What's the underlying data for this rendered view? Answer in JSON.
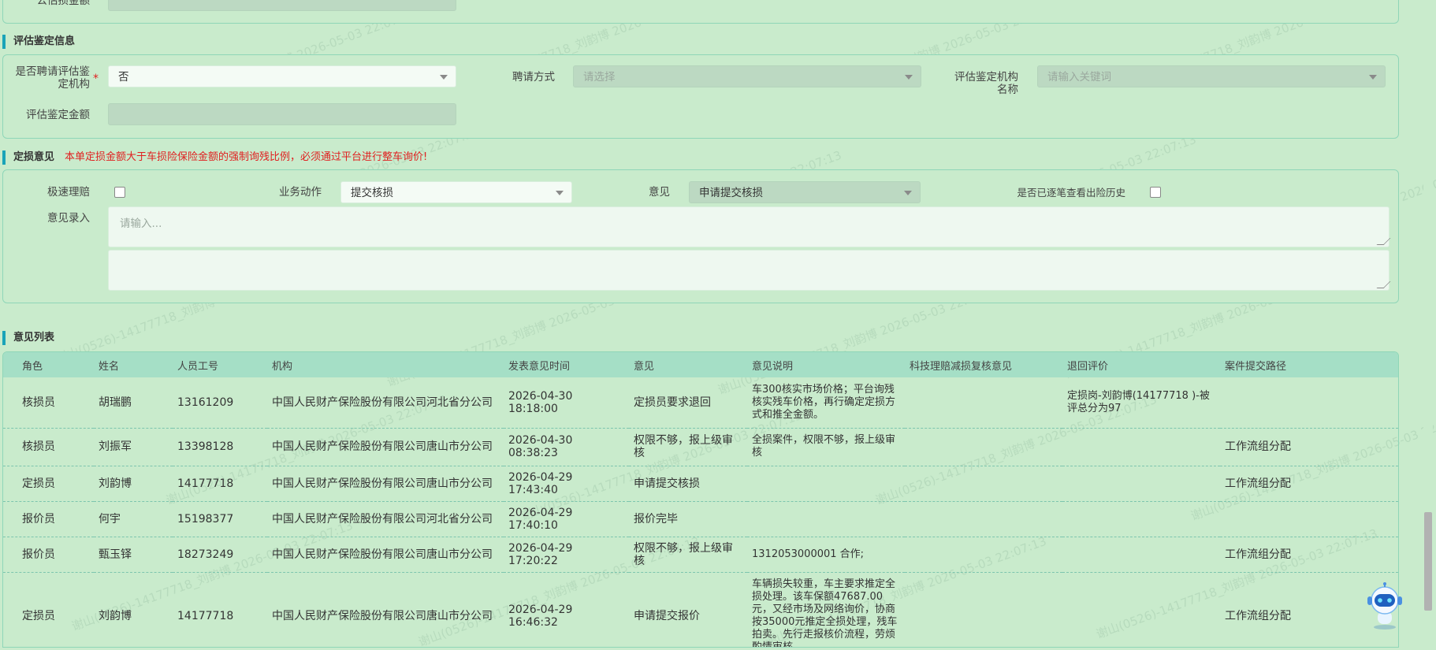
{
  "top_section": {
    "partial_label": "公估损金额"
  },
  "assessment": {
    "title": "评估鉴定信息",
    "hire_label": "是否聘请评估鉴定机构",
    "hire_value": "否",
    "hire_method_label": "聘请方式",
    "hire_method_placeholder": "请选择",
    "institution_label": "评估鉴定机构名称",
    "institution_placeholder": "请输入关键词",
    "amount_label": "评估鉴定金额"
  },
  "opinion": {
    "title": "定损意见",
    "warning": "本单定损金额大于车损险保险金额的强制询残比例，必须通过平台进行整车询价!",
    "warning_color": "#e02020",
    "fast_claim_label": "极速理赔",
    "business_action_label": "业务动作",
    "business_action_value": "提交核损",
    "opinion_label": "意见",
    "opinion_value": "申请提交核损",
    "history_label": "是否已逐笔查看出险历史",
    "opinion_input_label": "意见录入",
    "opinion_input_placeholder": "请输入..."
  },
  "opinion_list": {
    "title": "意见列表",
    "columns": [
      "角色",
      "姓名",
      "人员工号",
      "机构",
      "发表意见时间",
      "意见",
      "意见说明",
      "科技理赔减损复核意见",
      "退回评价",
      "案件提交路径"
    ],
    "rows": [
      [
        "核损员",
        "胡瑞鹏",
        "13161209",
        "中国人民财产保险股份有限公司河北省分公司",
        "2026-04-30 18:18:00",
        "定损员要求退回",
        "车300核实市场价格；平台询残核实残车价格，再行确定定损方式和推全金额。",
        "",
        "定损岗-刘韵博(14177718 )-被评总分为97",
        ""
      ],
      [
        "核损员",
        "刘振军",
        "13398128",
        "中国人民财产保险股份有限公司唐山市分公司",
        "2026-04-30 08:38:23",
        "权限不够，报上级审核",
        "全损案件，权限不够，报上级审核",
        "",
        "",
        "工作流组分配"
      ],
      [
        "定损员",
        "刘韵博",
        "14177718",
        "中国人民财产保险股份有限公司唐山市分公司",
        "2026-04-29 17:43:40",
        "申请提交核损",
        "",
        "",
        "",
        "工作流组分配"
      ],
      [
        "报价员",
        "何宇",
        "15198377",
        "中国人民财产保险股份有限公司河北省分公司",
        "2026-04-29 17:40:10",
        "报价完毕",
        "",
        "",
        "",
        ""
      ],
      [
        "报价员",
        "甄玉铎",
        "18273249",
        "中国人民财产保险股份有限公司唐山市分公司",
        "2026-04-29 17:20:22",
        "权限不够，报上级审核",
        "1312053000001 合作;",
        "",
        "",
        "工作流组分配"
      ],
      [
        "定损员",
        "刘韵博",
        "14177718",
        "中国人民财产保险股份有限公司唐山市分公司",
        "2026-04-29 16:46:32",
        "申请提交报价",
        "车辆损失较重，车主要求推定全损处理。该车保额47687.00元，又经市场及网络询价，协商按35000元推定全损处理，残车拍卖。先行走报核价流程，劳烦酌情审核。",
        "",
        "",
        "工作流组分配"
      ]
    ]
  },
  "watermark_text": "谢山(0526)-14177718_刘韵博 2026-05-03 22:07:13",
  "colors": {
    "accent": "#1aa3b8",
    "header_bg": "#a5dfc6",
    "page_bg": "#c9ebcc"
  }
}
